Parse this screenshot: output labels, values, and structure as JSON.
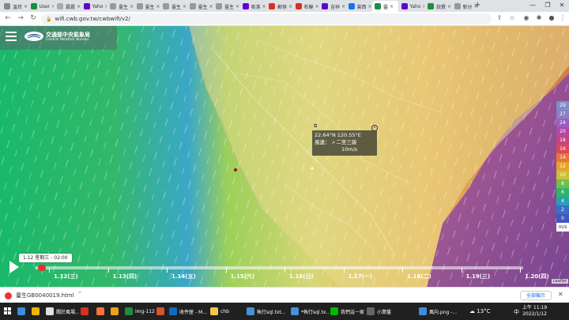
{
  "browser": {
    "tabs": [
      {
        "label": "溫世",
        "color": "#888888"
      },
      {
        "label": "User",
        "color": "#1e8e3e"
      },
      {
        "label": "霧霧",
        "color": "#aaaaaa"
      },
      {
        "label": "Yaho",
        "color": "#5f01d1"
      },
      {
        "label": "臺生",
        "color": "#999999"
      },
      {
        "label": "臺生",
        "color": "#999999"
      },
      {
        "label": "臺生",
        "color": "#999999"
      },
      {
        "label": "臺生",
        "color": "#999999"
      },
      {
        "label": "臺生",
        "color": "#999999"
      },
      {
        "label": "吸沸",
        "color": "#5f01d1"
      },
      {
        "label": "郵供",
        "color": "#d93025"
      },
      {
        "label": "布聯",
        "color": "#d93025"
      },
      {
        "label": "吉祥",
        "color": "#5f01d1"
      },
      {
        "label": "曾西",
        "color": "#1a73e8"
      },
      {
        "label": "靈",
        "color": "#1e8e3e"
      },
      {
        "label": "Yaho",
        "color": "#5f01d1"
      },
      {
        "label": "說費",
        "color": "#1e8e3e"
      },
      {
        "label": "新分",
        "color": "#999999"
      }
    ],
    "new_tab": "+",
    "url": "wifi.cwb.gov.tw/cwbwifi/v2/"
  },
  "map": {
    "agency_zh": "交通部中央氣象局",
    "agency_en": "Central Weather Bureau",
    "popup": {
      "coords": "22.64°N  120.55°E",
      "wind_label": "風速：",
      "beaufort": "二至三級",
      "speed": "10m/s"
    },
    "legend": {
      "levels": [
        {
          "value": "29",
          "color": "#7f8fc4"
        },
        {
          "value": "27",
          "color": "#8a7fc8"
        },
        {
          "value": "24",
          "color": "#9a5fbf"
        },
        {
          "value": "20",
          "color": "#b04aa8"
        },
        {
          "value": "18",
          "color": "#c2457f"
        },
        {
          "value": "16",
          "color": "#d8495d"
        },
        {
          "value": "14",
          "color": "#e8753c"
        },
        {
          "value": "12",
          "color": "#e9a22c"
        },
        {
          "value": "10",
          "color": "#c9c23a"
        },
        {
          "value": "8",
          "color": "#6fc04a"
        },
        {
          "value": "6",
          "color": "#32b36a"
        },
        {
          "value": "4",
          "color": "#2a9fb2"
        },
        {
          "value": "2",
          "color": "#3a6fc8"
        },
        {
          "value": "0",
          "color": "#4256c0"
        }
      ],
      "unit": "m/s"
    },
    "timeline": {
      "current_label": "1.12 星期三 - 02:00",
      "days": [
        "1.12(三)",
        "1.13(四)",
        "1.14(五)",
        "1.15(六)",
        "1.16(日)",
        "1.17(一)",
        "1.18(二)",
        "1.19(三)",
        "1.20(四)"
      ],
      "progress": 0.01
    },
    "attribution": "Leaflet"
  },
  "downloads": {
    "file": "臺生GB0040019.html",
    "show_all": "全部顯示"
  },
  "taskbar": {
    "items": [
      {
        "label": "",
        "color": "#3c8dde"
      },
      {
        "label": "",
        "color": "#f0b400"
      },
      {
        "label": "關於風場...",
        "color": "#e0e0e0"
      },
      {
        "label": "",
        "color": "#d93025"
      },
      {
        "label": "",
        "color": "#ff7139"
      },
      {
        "label": "",
        "color": "#e8a317"
      },
      {
        "label": "img-1120...",
        "color": "#1e8e3e"
      },
      {
        "label": "",
        "color": "#d9532c"
      },
      {
        "label": "收件匣 - M...",
        "color": "#0f6cbd"
      },
      {
        "label": "chb",
        "color": "#f2c94c"
      },
      {
        "label": "執行sql.txt...",
        "color": "#4a90d9"
      },
      {
        "label": "*執行sql.tx...",
        "color": "#4a90d9"
      },
      {
        "label": "我們這一家",
        "color": "#00b900"
      },
      {
        "label": "小算盤",
        "color": "#666666"
      },
      {
        "label": "風向.png -...",
        "color": "#3c8dde"
      }
    ],
    "temperature": "13°C",
    "ime": "中",
    "time": "上午 11:19",
    "date": "2022/1/12"
  }
}
